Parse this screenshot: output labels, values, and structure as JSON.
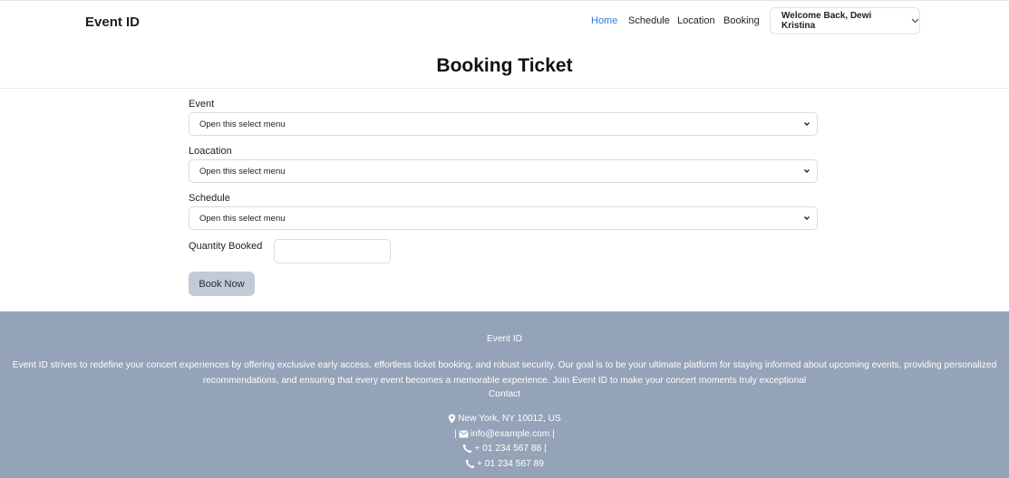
{
  "navbar": {
    "brand": "Event ID",
    "links": [
      "Home",
      "Schedule",
      "Location",
      "Booking"
    ],
    "user_menu": "Welcome Back, Dewi Kristina"
  },
  "page": {
    "title": "Booking Ticket"
  },
  "form": {
    "event": {
      "label": "Event",
      "value": "Open this select menu"
    },
    "location": {
      "label": "Loacation",
      "value": "Open this select menu"
    },
    "schedule": {
      "label": "Schedule",
      "value": "Open this select menu"
    },
    "quantity": {
      "label": "Quantity Booked",
      "value": ""
    },
    "submit_label": "Book Now"
  },
  "footer": {
    "title": "Event ID",
    "description": "Event ID strives to redefine your concert experiences by offering exclusive early access, effortless ticket booking, and robust security. Our goal is to be your ultimate platform for staying informed about upcoming events, providing personalized recommendations, and ensuring that every event becomes a memorable experience. Join Event ID to make your concert moments truly exceptional",
    "contact_heading": "Contact",
    "address": "New York, NY 10012, US",
    "email_prefix": "|",
    "email": "info@example.com |",
    "phone1": "+ 01 234 567 88 |",
    "phone2": "+ 01 234 567 89"
  },
  "colors": {
    "active_link": "#2f7ce0",
    "footer_bg": "#94a3b8",
    "button_bg": "#c1cbd8"
  }
}
